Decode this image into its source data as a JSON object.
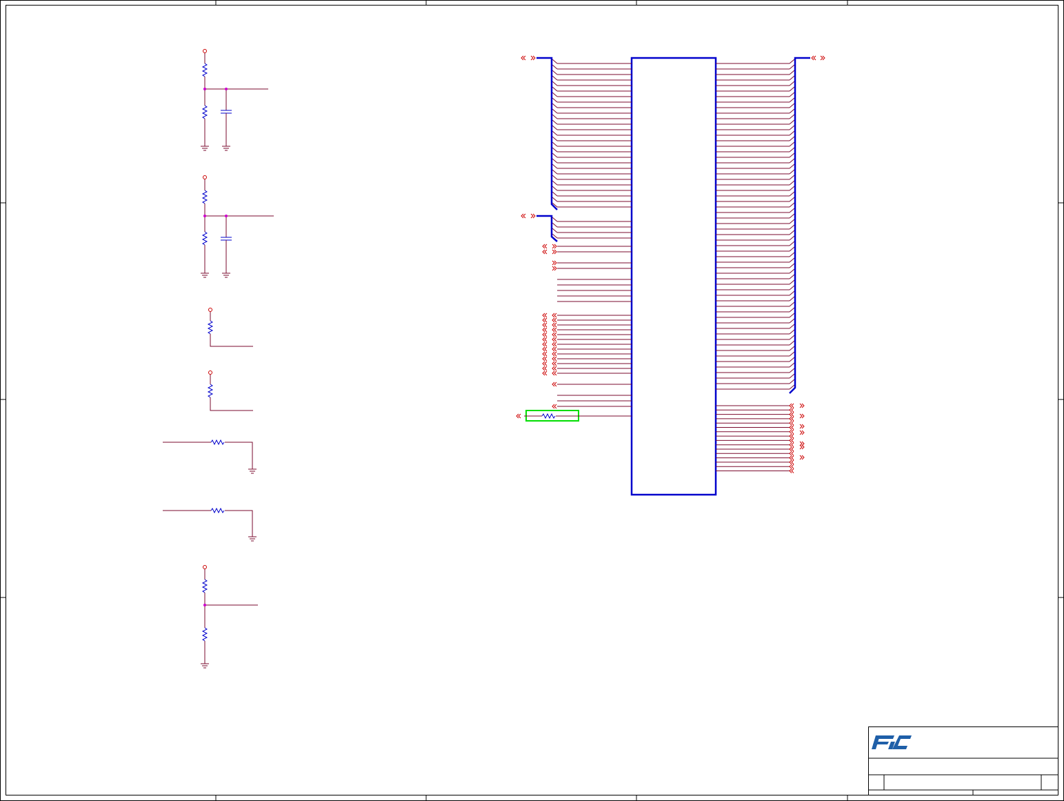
{
  "sheet": {
    "background": "#ffffff",
    "border_color": "#000000"
  },
  "colors": {
    "wire": "#7a0a2e",
    "net_red": "#cc0000",
    "bus_blue": "#0000cc",
    "component_blue": "#0000cc",
    "junction_magenta": "#cc00cc",
    "highlight_green": "#00dd00",
    "logo_blue": "#1f5fa8"
  },
  "title_block": {
    "logo_icon": "fic-logo-icon"
  },
  "connector_ports": {
    "left_bus_ports": 2,
    "left_single_ports": 27,
    "right_bus_ports": 1,
    "right_single_ports": 17
  }
}
